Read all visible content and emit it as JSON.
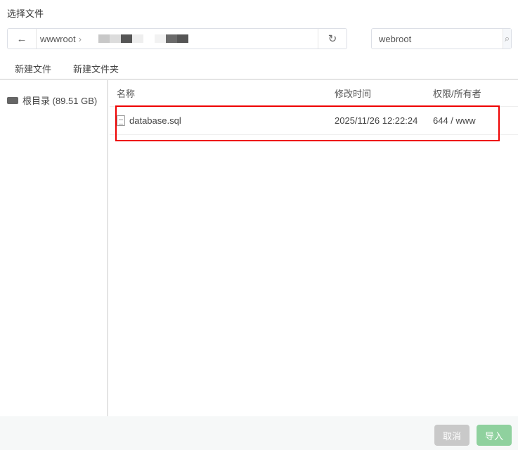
{
  "dialog": {
    "title": "选择文件"
  },
  "path": {
    "segments": [
      "wwwroot"
    ],
    "blurred_segment_colors": [
      "#c8c8c8",
      "#dcdcdc",
      "#555555",
      "#eeeeee",
      "#ffffff",
      "#f2f2f2",
      "#6a6a6a",
      "#555555"
    ]
  },
  "search": {
    "value": "webroot"
  },
  "toolbar": {
    "new_file": "新建文件",
    "new_folder": "新建文件夹"
  },
  "sidebar": {
    "items": [
      {
        "label": "根目录 (89.51 GB)"
      }
    ]
  },
  "table": {
    "headers": {
      "name": "名称",
      "modified": "修改时间",
      "perm": "权限/所有者"
    },
    "rows": [
      {
        "name": "database.sql",
        "modified": "2025/11/26 12:22:24",
        "perm": "644 / www"
      }
    ]
  },
  "footer": {
    "cancel": "取消",
    "import": "导入"
  },
  "colors": {
    "highlight": "#ee0000",
    "primary_disabled": "#8fd19e"
  }
}
